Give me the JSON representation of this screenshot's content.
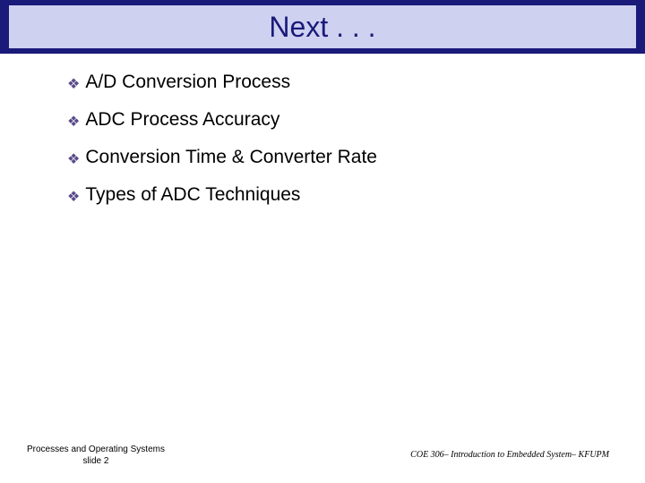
{
  "title": "Next . . .",
  "bullets": [
    "A/D Conversion Process",
    "ADC Process Accuracy",
    "Conversion Time & Converter Rate",
    "Types of ADC Techniques"
  ],
  "footer": {
    "left_line1": "Processes and Operating Systems",
    "left_line2": "slide 2",
    "right": "COE 306– Introduction to Embedded System– KFUPM"
  }
}
